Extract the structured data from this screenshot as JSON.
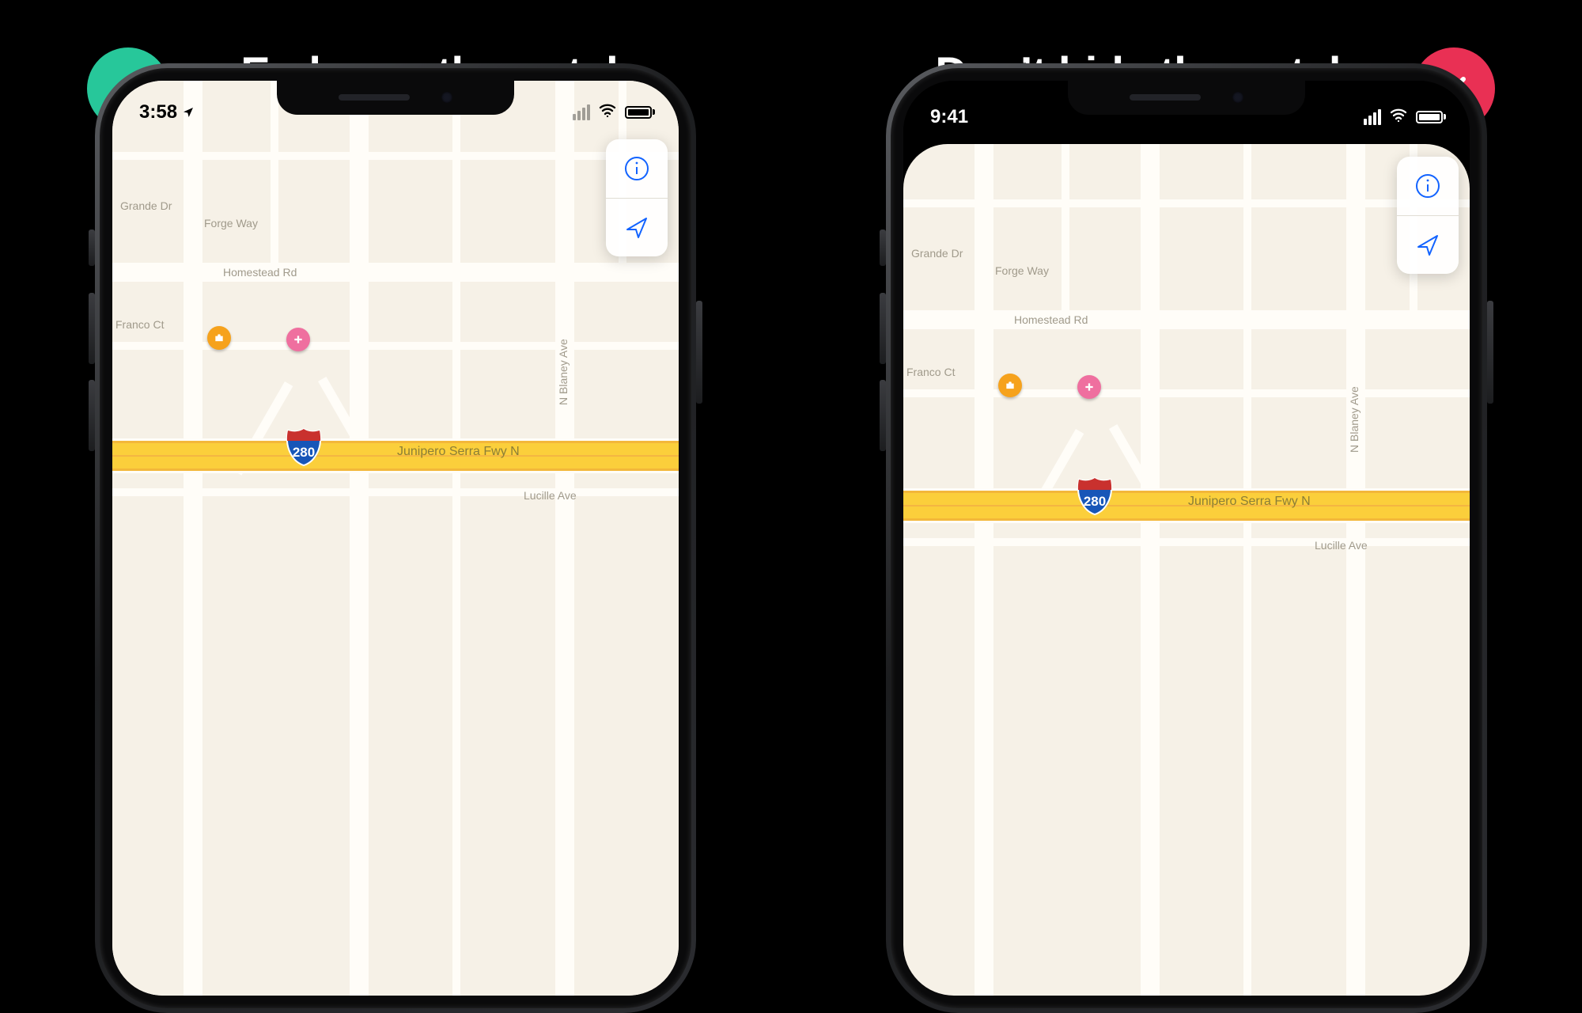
{
  "good": {
    "title": "Embrace the notch",
    "status": {
      "time": "3:58",
      "location_arrow": true
    },
    "map": {
      "streets": {
        "grande_dr": "Grande Dr",
        "forge_way": "Forge Way",
        "homestead_rd": "Homestead Rd",
        "franco_ct": "Franco Ct",
        "n_blaney_ave": "N Blaney Ave",
        "lucille_ave": "Lucille Ave",
        "junipero_serra": "Junipero Serra Fwy N"
      },
      "shield": "280"
    }
  },
  "bad": {
    "title": "Don’t hide the notch",
    "status": {
      "time": "9:41"
    },
    "map": {
      "streets": {
        "grande_dr": "Grande Dr",
        "forge_way": "Forge Way",
        "homestead_rd": "Homestead Rd",
        "franco_ct": "Franco Ct",
        "n_blaney_ave": "N Blaney Ave",
        "lucille_ave": "Lucille Ave",
        "junipero_serra": "Junipero Serra Fwy N"
      },
      "shield": "280"
    }
  },
  "colors": {
    "good": "#27c79a",
    "bad": "#e93054",
    "accent": "#1263ff"
  }
}
